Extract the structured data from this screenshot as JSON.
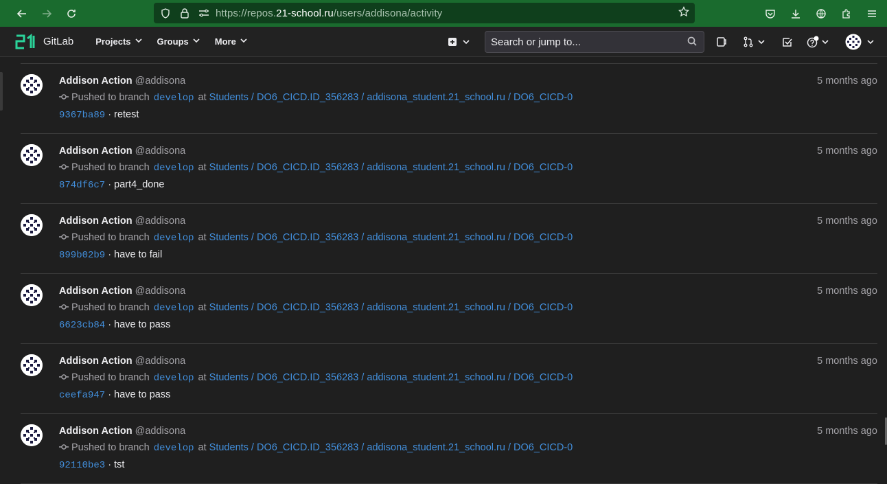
{
  "browser": {
    "url_prefix": "https://repos.",
    "url_host": "21-school.ru",
    "url_path": "/users/addisona/activity"
  },
  "header": {
    "app_name": "GitLab",
    "menu": [
      {
        "label": "Projects"
      },
      {
        "label": "Groups"
      },
      {
        "label": "More"
      }
    ],
    "search_placeholder": "Search or jump to..."
  },
  "events": [
    {
      "author": "Addison Action",
      "username": "@addisona",
      "time": "5 months ago",
      "action": "Pushed to branch",
      "branch": "develop",
      "at": "at",
      "project": "Students / DO6_CICD.ID_356283 / addisona_student.21_school.ru / DO6_CICD-0",
      "sha": "9367ba89",
      "message": "retest"
    },
    {
      "author": "Addison Action",
      "username": "@addisona",
      "time": "5 months ago",
      "action": "Pushed to branch",
      "branch": "develop",
      "at": "at",
      "project": "Students / DO6_CICD.ID_356283 / addisona_student.21_school.ru / DO6_CICD-0",
      "sha": "874df6c7",
      "message": "part4_done"
    },
    {
      "author": "Addison Action",
      "username": "@addisona",
      "time": "5 months ago",
      "action": "Pushed to branch",
      "branch": "develop",
      "at": "at",
      "project": "Students / DO6_CICD.ID_356283 / addisona_student.21_school.ru / DO6_CICD-0",
      "sha": "899b02b9",
      "message": "have to fail"
    },
    {
      "author": "Addison Action",
      "username": "@addisona",
      "time": "5 months ago",
      "action": "Pushed to branch",
      "branch": "develop",
      "at": "at",
      "project": "Students / DO6_CICD.ID_356283 / addisona_student.21_school.ru / DO6_CICD-0",
      "sha": "6623cb84",
      "message": "have to pass"
    },
    {
      "author": "Addison Action",
      "username": "@addisona",
      "time": "5 months ago",
      "action": "Pushed to branch",
      "branch": "develop",
      "at": "at",
      "project": "Students / DO6_CICD.ID_356283 / addisona_student.21_school.ru / DO6_CICD-0",
      "sha": "ceefa947",
      "message": "have to pass"
    },
    {
      "author": "Addison Action",
      "username": "@addisona",
      "time": "5 months ago",
      "action": "Pushed to branch",
      "branch": "develop",
      "at": "at",
      "project": "Students / DO6_CICD.ID_356283 / addisona_student.21_school.ru / DO6_CICD-0",
      "sha": "92110be3",
      "message": "tst"
    }
  ],
  "colors": {
    "browser_bar": "#1a6b2e",
    "link": "#428fdc",
    "background": "#1f1f1f",
    "logo_accent": "#2bd49b"
  }
}
